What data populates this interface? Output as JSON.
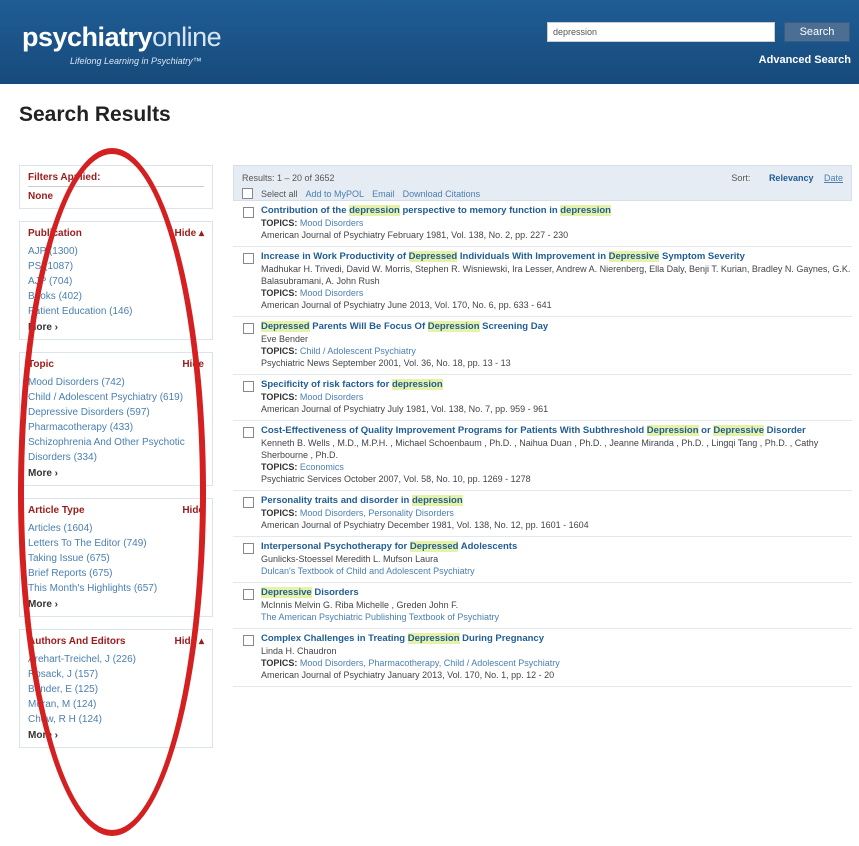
{
  "header": {
    "logo_bold": "psychiatry",
    "logo_light": "online",
    "tagline": "Lifelong Learning in Psychiatry™",
    "search_value": "depression",
    "search_button": "Search",
    "advanced_search": "Advanced Search"
  },
  "page_title": "Search Results",
  "sidebar": {
    "applied": {
      "label": "Filters Applied:",
      "value": "None"
    },
    "publication": {
      "label": "Publication",
      "hide": "Hide ▴",
      "items": [
        "AJP (1300)",
        "PS (1087)",
        "AJP (704)",
        "Books (402)",
        "Patient Education (146)"
      ],
      "more": "More ›"
    },
    "topic": {
      "label": "Topic",
      "hide": "Hide",
      "items": [
        "Mood Disorders (742)",
        "Child / Adolescent Psychiatry (619)",
        "Depressive Disorders (597)",
        "Pharmacotherapy (433)",
        "Schizophrenia And Other Psychotic Disorders (334)"
      ],
      "more": "More ›"
    },
    "article_type": {
      "label": "Article Type",
      "hide": "Hide",
      "items": [
        "Articles (1604)",
        "Letters To The Editor (749)",
        "Taking Issue (675)",
        "Brief Reports (675)",
        "This Month's Highlights (657)"
      ],
      "more": "More ›"
    },
    "authors": {
      "label": "Authors And Editors",
      "hide": "Hide ▴",
      "items": [
        "Arehart-Treichel, J (226)",
        "Rosack, J (157)",
        "Bender, E (125)",
        "Moran, M (124)",
        "Chew, R H (124)"
      ],
      "more": "More ›"
    }
  },
  "results_bar": {
    "count": "Results: 1 – 20 of 3652",
    "sort_label": "Sort:",
    "sort_relevancy": "Relevancy",
    "sort_date": "Date",
    "select_all": "Select all",
    "add_mypol": "Add to MyPOL",
    "email": "Email",
    "download": "Download Citations"
  },
  "results": [
    {
      "title_parts": [
        "Contribution of the ",
        "depression",
        " perspective to memory function in ",
        "depression"
      ],
      "topics_label": "TOPICS:",
      "topics": "Mood Disorders",
      "source": "American Journal of Psychiatry February 1981, Vol. 138, No. 2, pp. 227 - 230"
    },
    {
      "title_parts": [
        "Increase in Work Productivity of ",
        "Depressed",
        " Individuals With Improvement in ",
        "Depressive",
        " Symptom Severity"
      ],
      "authors": "Madhukar H. Trivedi, David W. Morris, Stephen R. Wisniewski, Ira Lesser, Andrew A. Nierenberg, Ella Daly, Benji T. Kurian, Bradley N. Gaynes, G.K. Balasubramani, A. John Rush",
      "topics_label": "TOPICS:",
      "topics": "Mood Disorders",
      "source": "American Journal of Psychiatry June 2013, Vol. 170, No. 6, pp. 633 - 641"
    },
    {
      "title_parts": [
        "",
        "Depressed",
        " Parents Will Be Focus Of ",
        "Depression",
        " Screening Day"
      ],
      "authors": "Eve Bender",
      "topics_label": "TOPICS:",
      "topics": "Child / Adolescent Psychiatry",
      "source": "Psychiatric News September 2001, Vol. 36, No. 18, pp. 13 - 13"
    },
    {
      "title_parts": [
        "Specificity of risk factors for ",
        "depression"
      ],
      "topics_label": "TOPICS:",
      "topics": "Mood Disorders",
      "source": "American Journal of Psychiatry July 1981, Vol. 138, No. 7, pp. 959 - 961"
    },
    {
      "title_parts": [
        "Cost-Effectiveness of Quality Improvement Programs for Patients With Subthreshold ",
        "Depression",
        " or ",
        "Depressive",
        " Disorder"
      ],
      "authors": "Kenneth B. Wells , M.D., M.P.H. , Michael Schoenbaum , Ph.D. , Naihua Duan , Ph.D. , Jeanne Miranda , Ph.D. , Lingqi Tang , Ph.D. , Cathy Sherbourne , Ph.D.",
      "topics_label": "TOPICS:",
      "topics": "Economics",
      "source": "Psychiatric Services October 2007, Vol. 58, No. 10, pp. 1269 - 1278"
    },
    {
      "title_parts": [
        "Personality traits and disorder in ",
        "depression"
      ],
      "topics_label": "TOPICS:",
      "topics": "Mood Disorders, Personality Disorders",
      "source": "American Journal of Psychiatry December 1981, Vol. 138, No. 12, pp. 1601 - 1604"
    },
    {
      "title_parts": [
        "Interpersonal Psychotherapy for ",
        "Depressed",
        " Adolescents"
      ],
      "authors": "Gunlicks-Stoessel Meredith L. Mufson Laura",
      "source_link": "Dulcan's Textbook of Child and Adolescent Psychiatry"
    },
    {
      "title_parts": [
        "",
        "Depressive",
        " Disorders"
      ],
      "authors": "McInnis Melvin G. Riba Michelle , Greden John F.",
      "source_link": "The American Psychiatric Publishing Textbook of Psychiatry"
    },
    {
      "title_parts": [
        "Complex Challenges in Treating ",
        "Depression",
        " During Pregnancy"
      ],
      "authors": "Linda H. Chaudron",
      "topics_label": "TOPICS:",
      "topics": "Mood Disorders, Pharmacotherapy, Child / Adolescent Psychiatry",
      "source": "American Journal of Psychiatry January 2013, Vol. 170, No. 1, pp. 12 - 20"
    }
  ]
}
